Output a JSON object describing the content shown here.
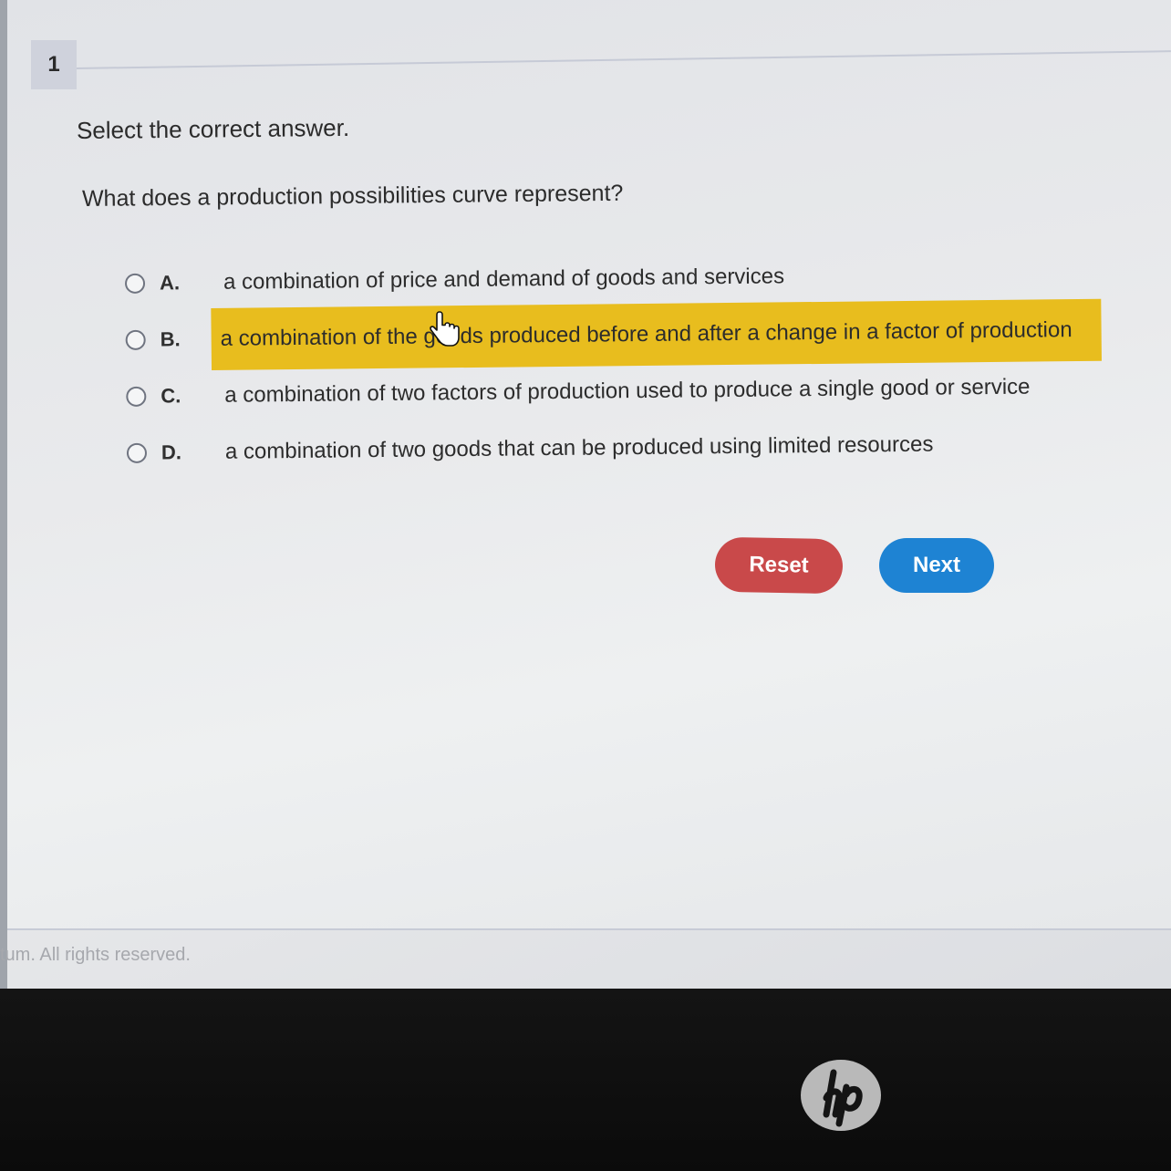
{
  "question": {
    "number": "1",
    "instruction": "Select the correct answer.",
    "prompt": "What does a production possibilities curve represent?"
  },
  "options": [
    {
      "letter": "A.",
      "text": "a combination of price and demand of goods and services",
      "highlighted": false
    },
    {
      "letter": "B.",
      "text": "a combination of the goods produced before and after a change in a factor of production",
      "highlighted": true
    },
    {
      "letter": "C.",
      "text": "a combination of two factors of production used to produce a single good or service",
      "highlighted": false
    },
    {
      "letter": "D.",
      "text": "a combination of two goods that can be produced using limited resources",
      "highlighted": false
    }
  ],
  "buttons": {
    "reset_label": "Reset",
    "next_label": "Next"
  },
  "footer": {
    "copyright": "tum. All rights reserved."
  },
  "colors": {
    "highlight": "#e8bd1e",
    "reset": "#c9494a",
    "next": "#1e83d3"
  },
  "icons": {
    "cursor": "hand-pointer-icon",
    "logo": "hp-logo"
  }
}
